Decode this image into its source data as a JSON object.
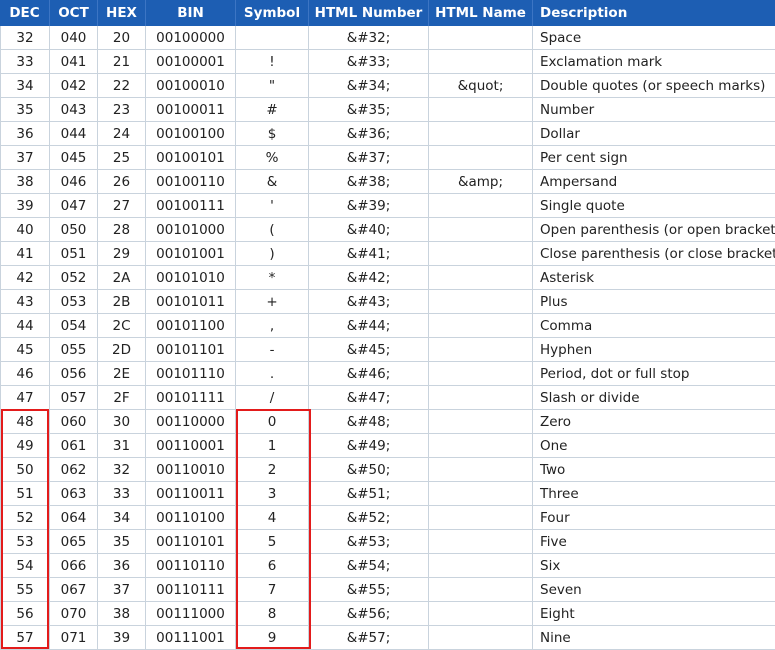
{
  "headers": [
    "DEC",
    "OCT",
    "HEX",
    "BIN",
    "Symbol",
    "HTML Number",
    "HTML Name",
    "Description"
  ],
  "rows": [
    [
      "32",
      "040",
      "20",
      "00100000",
      "",
      "&#32;",
      "",
      "Space"
    ],
    [
      "33",
      "041",
      "21",
      "00100001",
      "!",
      "&#33;",
      "",
      "Exclamation mark"
    ],
    [
      "34",
      "042",
      "22",
      "00100010",
      "\"",
      "&#34;",
      "&quot;",
      "Double quotes (or speech marks)"
    ],
    [
      "35",
      "043",
      "23",
      "00100011",
      "#",
      "&#35;",
      "",
      "Number"
    ],
    [
      "36",
      "044",
      "24",
      "00100100",
      "$",
      "&#36;",
      "",
      "Dollar"
    ],
    [
      "37",
      "045",
      "25",
      "00100101",
      "%",
      "&#37;",
      "",
      "Per cent sign"
    ],
    [
      "38",
      "046",
      "26",
      "00100110",
      "&",
      "&#38;",
      "&amp;",
      "Ampersand"
    ],
    [
      "39",
      "047",
      "27",
      "00100111",
      "'",
      "&#39;",
      "",
      "Single quote"
    ],
    [
      "40",
      "050",
      "28",
      "00101000",
      "(",
      "&#40;",
      "",
      "Open parenthesis (or open bracket)"
    ],
    [
      "41",
      "051",
      "29",
      "00101001",
      ")",
      "&#41;",
      "",
      "Close parenthesis (or close bracket)"
    ],
    [
      "42",
      "052",
      "2A",
      "00101010",
      "*",
      "&#42;",
      "",
      "Asterisk"
    ],
    [
      "43",
      "053",
      "2B",
      "00101011",
      "+",
      "&#43;",
      "",
      "Plus"
    ],
    [
      "44",
      "054",
      "2C",
      "00101100",
      ",",
      "&#44;",
      "",
      "Comma"
    ],
    [
      "45",
      "055",
      "2D",
      "00101101",
      "-",
      "&#45;",
      "",
      "Hyphen"
    ],
    [
      "46",
      "056",
      "2E",
      "00101110",
      ".",
      "&#46;",
      "",
      "Period, dot or full stop"
    ],
    [
      "47",
      "057",
      "2F",
      "00101111",
      "/",
      "&#47;",
      "",
      "Slash or divide"
    ],
    [
      "48",
      "060",
      "30",
      "00110000",
      "0",
      "&#48;",
      "",
      "Zero"
    ],
    [
      "49",
      "061",
      "31",
      "00110001",
      "1",
      "&#49;",
      "",
      "One"
    ],
    [
      "50",
      "062",
      "32",
      "00110010",
      "2",
      "&#50;",
      "",
      "Two"
    ],
    [
      "51",
      "063",
      "33",
      "00110011",
      "3",
      "&#51;",
      "",
      "Three"
    ],
    [
      "52",
      "064",
      "34",
      "00110100",
      "4",
      "&#52;",
      "",
      "Four"
    ],
    [
      "53",
      "065",
      "35",
      "00110101",
      "5",
      "&#53;",
      "",
      "Five"
    ],
    [
      "54",
      "066",
      "36",
      "00110110",
      "6",
      "&#54;",
      "",
      "Six"
    ],
    [
      "55",
      "067",
      "37",
      "00110111",
      "7",
      "&#55;",
      "",
      "Seven"
    ],
    [
      "56",
      "070",
      "38",
      "00111000",
      "8",
      "&#56;",
      "",
      "Eight"
    ],
    [
      "57",
      "071",
      "39",
      "00111001",
      "9",
      "&#57;",
      "",
      "Nine"
    ]
  ],
  "colors": {
    "header_bg": "#1d5eb3",
    "highlight": "#e31b1b",
    "grid": "#c9d3dd"
  }
}
